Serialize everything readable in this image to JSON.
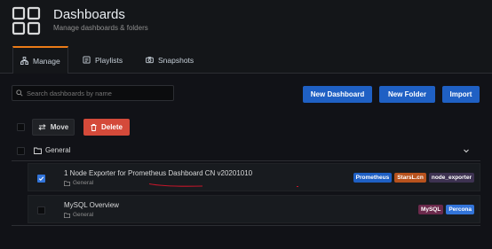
{
  "header": {
    "title": "Dashboards",
    "subtitle": "Manage dashboards & folders",
    "icon": "apps-grid-icon"
  },
  "tabs": [
    {
      "label": "Manage",
      "icon": "sitemap-icon",
      "active": true
    },
    {
      "label": "Playlists",
      "icon": "playlist-icon",
      "active": false
    },
    {
      "label": "Snapshots",
      "icon": "camera-icon",
      "active": false
    }
  ],
  "search": {
    "placeholder": "Search dashboards by name",
    "value": ""
  },
  "actions": {
    "new_dashboard": "New Dashboard",
    "new_folder": "New Folder",
    "import": "Import"
  },
  "bulk": {
    "move": "Move",
    "delete": "Delete"
  },
  "folder": {
    "name": "General",
    "expanded": true
  },
  "dashboards": [
    {
      "title": "1 Node Exporter for Prometheus Dashboard CN v20201010",
      "folder": "General",
      "checked": true,
      "tags": [
        {
          "label": "Prometheus",
          "color": "#1f60c4"
        },
        {
          "label": "StarsL.cn",
          "color": "#b7521d"
        },
        {
          "label": "node_exporter",
          "color": "#3d3251"
        }
      ]
    },
    {
      "title": "MySQL Overview",
      "folder": "General",
      "checked": false,
      "tags": [
        {
          "label": "MySQL",
          "color": "#6b2a4c"
        },
        {
          "label": "Percona",
          "color": "#3274d9"
        }
      ]
    }
  ],
  "colors": {
    "accent": "#eb7b18",
    "primary": "#1f60c4",
    "danger": "#d44a3a",
    "annotation": "#c4162a"
  }
}
